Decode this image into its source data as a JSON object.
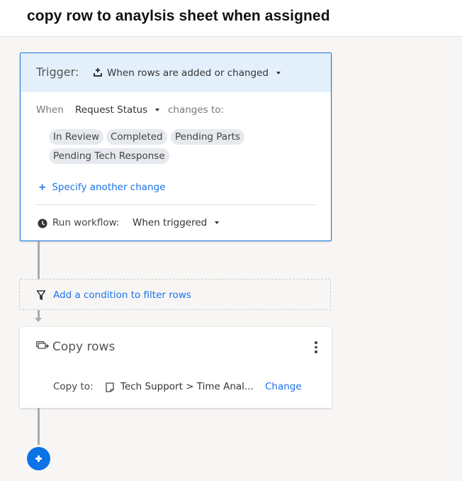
{
  "header": {
    "title": "copy row to anaylsis sheet when assigned"
  },
  "trigger": {
    "label": "Trigger:",
    "icon": "row-add-icon",
    "value": "When rows are added or changed",
    "when_label": "When",
    "field": "Request Status",
    "changes_label": "changes to:",
    "values": [
      "In Review",
      "Completed",
      "Pending Parts",
      "Pending Tech Response"
    ],
    "specify_plus": "+",
    "specify_label": "Specify another change",
    "run_label": "Run workflow:",
    "run_value": "When triggered"
  },
  "condition": {
    "label": "Add a condition to filter rows",
    "icon": "filter-icon"
  },
  "action": {
    "title": "Copy rows",
    "icon": "copy-rows-icon",
    "copy_to_label": "Copy to:",
    "destination": "Tech Support > Time Anal...",
    "change_label": "Change"
  },
  "colors": {
    "accent": "#1a73e8",
    "trigger_bg": "#e3f0fc",
    "add_button": "#0b73e6"
  }
}
